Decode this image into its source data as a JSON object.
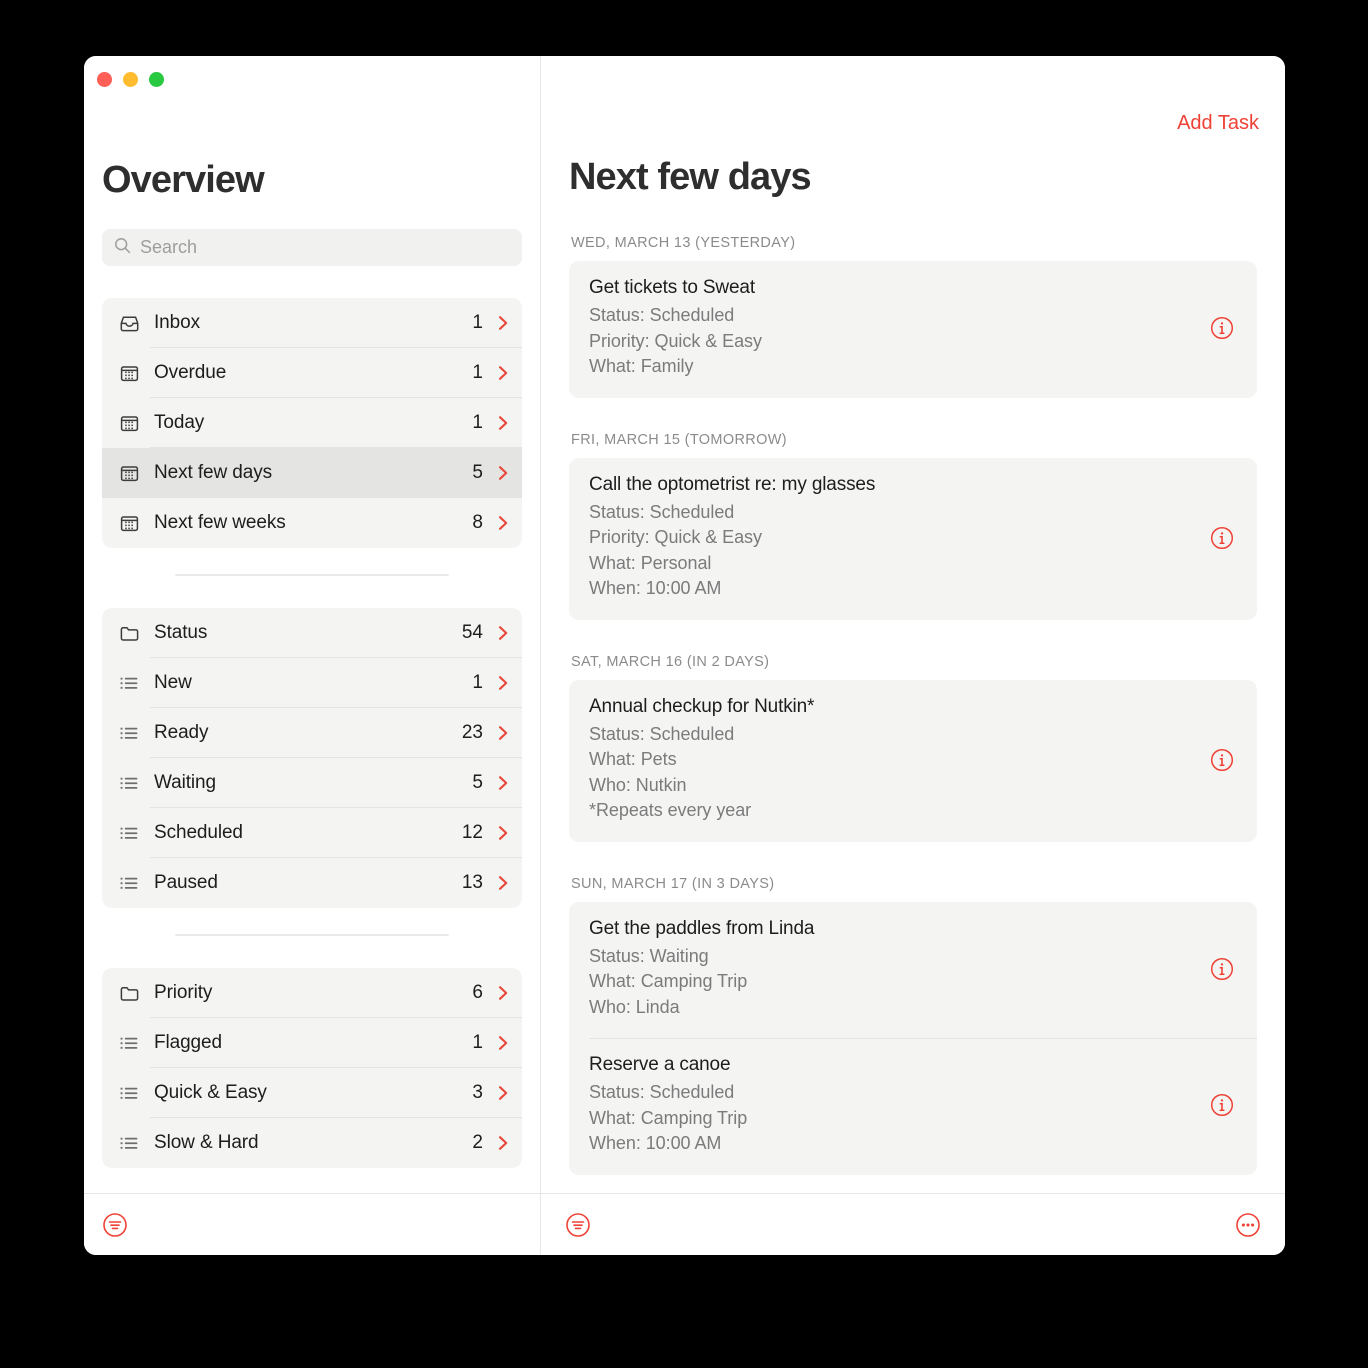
{
  "window": {
    "traffic_lights": [
      {
        "name": "close",
        "color": "#ff5f57"
      },
      {
        "name": "minimize",
        "color": "#febc2e"
      },
      {
        "name": "maximize",
        "color": "#28c840"
      }
    ]
  },
  "accent_color": "#ef4135",
  "sidebar": {
    "title": "Overview",
    "search": {
      "value": "",
      "placeholder": "Search"
    },
    "groups": [
      {
        "name": "smart-lists",
        "items": [
          {
            "icon": "inbox-icon",
            "label": "Inbox",
            "count": "1",
            "selected": false
          },
          {
            "icon": "calendar-icon",
            "label": "Overdue",
            "count": "1",
            "selected": false
          },
          {
            "icon": "calendar-icon",
            "label": "Today",
            "count": "1",
            "selected": false
          },
          {
            "icon": "calendar-icon",
            "label": "Next few days",
            "count": "5",
            "selected": true
          },
          {
            "icon": "calendar-icon",
            "label": "Next few weeks",
            "count": "8",
            "selected": false
          }
        ]
      },
      {
        "name": "status",
        "items": [
          {
            "icon": "folder-icon",
            "label": "Status",
            "count": "54",
            "selected": false
          },
          {
            "icon": "list-icon",
            "label": "New",
            "count": "1",
            "selected": false
          },
          {
            "icon": "list-icon",
            "label": "Ready",
            "count": "23",
            "selected": false
          },
          {
            "icon": "list-icon",
            "label": "Waiting",
            "count": "5",
            "selected": false
          },
          {
            "icon": "list-icon",
            "label": "Scheduled",
            "count": "12",
            "selected": false
          },
          {
            "icon": "list-icon",
            "label": "Paused",
            "count": "13",
            "selected": false
          }
        ]
      },
      {
        "name": "priority",
        "items": [
          {
            "icon": "folder-icon",
            "label": "Priority",
            "count": "6",
            "selected": false
          },
          {
            "icon": "list-icon",
            "label": "Flagged",
            "count": "1",
            "selected": false
          },
          {
            "icon": "list-icon",
            "label": "Quick & Easy",
            "count": "3",
            "selected": false
          },
          {
            "icon": "list-icon",
            "label": "Slow & Hard",
            "count": "2",
            "selected": false
          }
        ]
      }
    ]
  },
  "main": {
    "add_task_label": "Add Task",
    "title": "Next few days",
    "day_groups": [
      {
        "label": "WED, MARCH 13 (YESTERDAY)",
        "tasks": [
          {
            "title": "Get tickets to Sweat",
            "meta": [
              "Status: Scheduled",
              "Priority: Quick & Easy",
              "What: Family"
            ]
          }
        ]
      },
      {
        "label": "FRI, MARCH 15 (TOMORROW)",
        "tasks": [
          {
            "title": "Call the optometrist re: my glasses",
            "meta": [
              "Status: Scheduled",
              "Priority: Quick & Easy",
              "What: Personal",
              "When: 10:00 AM"
            ]
          }
        ]
      },
      {
        "label": "SAT, MARCH 16 (IN 2 DAYS)",
        "tasks": [
          {
            "title": "Annual checkup for Nutkin*",
            "meta": [
              "Status: Scheduled",
              "What: Pets",
              "Who: Nutkin",
              "*Repeats every year"
            ]
          }
        ]
      },
      {
        "label": "SUN, MARCH 17 (IN 3 DAYS)",
        "tasks": [
          {
            "title": "Get the paddles from Linda",
            "meta": [
              "Status: Waiting",
              "What: Camping Trip",
              "Who: Linda"
            ]
          },
          {
            "title": "Reserve a canoe",
            "meta": [
              "Status: Scheduled",
              "What: Camping Trip",
              "When: 10:00 AM"
            ]
          }
        ]
      }
    ]
  },
  "bottombar": {
    "left_button": "sort-filter-icon",
    "center_button": "sort-filter-icon",
    "right_button": "more-options-icon"
  }
}
